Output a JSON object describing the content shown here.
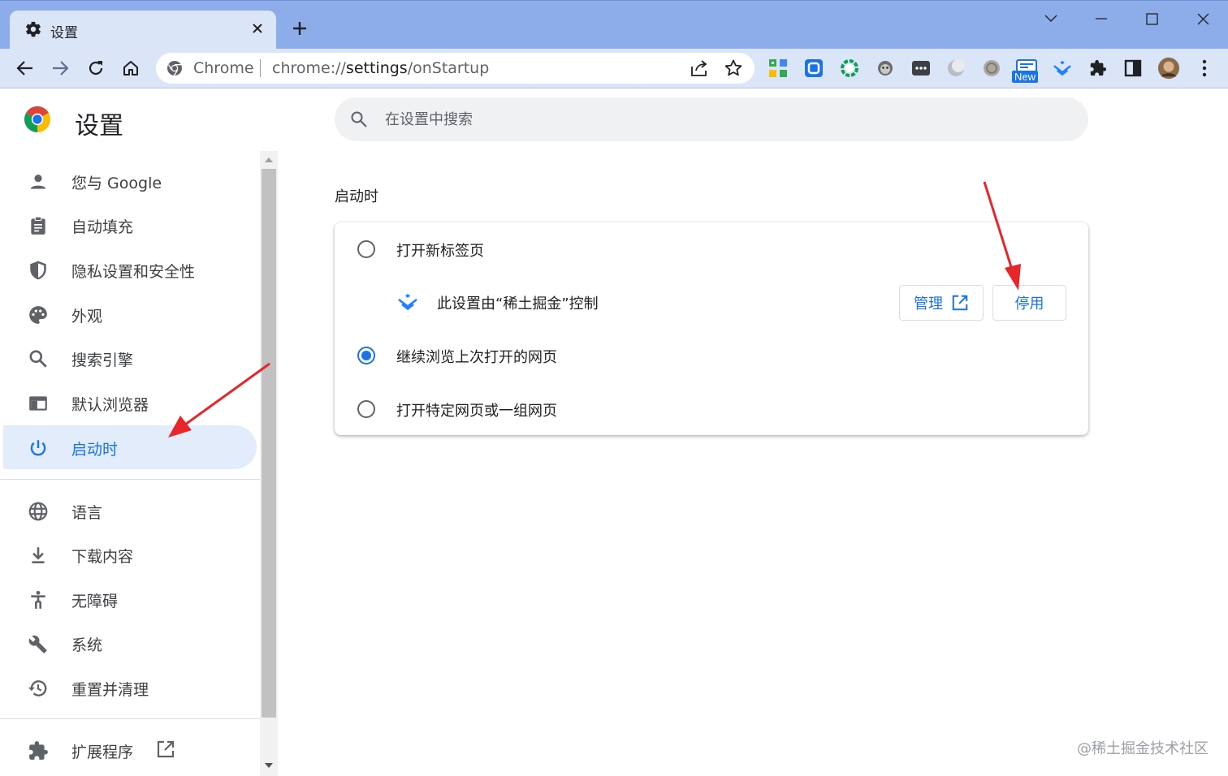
{
  "colors": {
    "accent": "#1a73e8",
    "tabstrip": "#8cadea",
    "toolbar": "#dbe5f8",
    "active_nav_bg": "#e3ecfb",
    "annotation": "#e8262a"
  },
  "tab": {
    "title": "设置",
    "icon": "gear-icon"
  },
  "omnibox": {
    "site_name": "Chrome",
    "url_scheme": "chrome://",
    "url_host": "settings",
    "url_path": "/onStartup"
  },
  "extensions": {
    "new_badge": "New"
  },
  "sidebar": {
    "title": "设置",
    "items": [
      {
        "label": "您与 Google",
        "icon": "person-icon"
      },
      {
        "label": "自动填充",
        "icon": "clipboard-icon"
      },
      {
        "label": "隐私设置和安全性",
        "icon": "shield-icon"
      },
      {
        "label": "外观",
        "icon": "palette-icon"
      },
      {
        "label": "搜索引擎",
        "icon": "search-icon"
      },
      {
        "label": "默认浏览器",
        "icon": "browser-window-icon"
      },
      {
        "label": "启动时",
        "icon": "power-icon",
        "active": true
      },
      {
        "label": "语言",
        "icon": "globe-icon"
      },
      {
        "label": "下载内容",
        "icon": "download-icon"
      },
      {
        "label": "无障碍",
        "icon": "accessibility-icon"
      },
      {
        "label": "系统",
        "icon": "wrench-icon"
      },
      {
        "label": "重置并清理",
        "icon": "restore-icon"
      },
      {
        "label": "扩展程序",
        "icon": "puzzle-icon"
      }
    ]
  },
  "search": {
    "placeholder": "在设置中搜索"
  },
  "startup": {
    "section_title": "启动时",
    "options": [
      {
        "label": "打开新标签页",
        "checked": false
      },
      {
        "label": "继续浏览上次打开的网页",
        "checked": true
      },
      {
        "label": "打开特定网页或一组网页",
        "checked": false
      }
    ],
    "controlled_text": "此设置由“稀土掘金”控制",
    "manage_label": "管理",
    "disable_label": "停用"
  },
  "watermark": "@稀土掘金技术社区"
}
